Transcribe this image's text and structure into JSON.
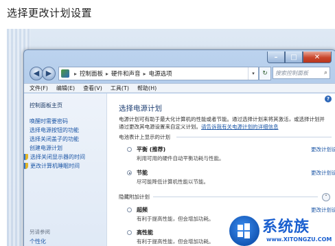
{
  "heading": "选择更改计划设置",
  "window": {
    "caption": {
      "min": "–",
      "max": "□",
      "close": "✕"
    },
    "nav": {
      "back": "◀",
      "forward": "▶"
    },
    "address": {
      "crumbs": [
        "控制面板",
        "硬件和声音",
        "电源选项"
      ],
      "separator": "▸",
      "dropdown": "▾"
    },
    "refresh": "↻",
    "search": {
      "placeholder": "搜索控制面板",
      "icon": "⌕"
    },
    "menu": [
      "文件(F)",
      "编辑(E)",
      "查看(V)",
      "工具(T)",
      "帮助(H)"
    ]
  },
  "sidebar": {
    "home": "控制面板主页",
    "links": [
      "唤醒时需要密码",
      "选择电源按钮的功能",
      "选择关闭盖子的功能",
      "创建电源计划",
      "选择关闭显示器的时间",
      "更改计算机睡眠时间"
    ],
    "see_also": "另请参阅",
    "personalize": "个性化"
  },
  "main": {
    "help": "?",
    "title": "选择电源计划",
    "desc_1": "电源计划可有助于最大化计算机的性能或者节能。通过选择计划来将其激活，或选择计划并通过更改其电源设置来自定义计划。",
    "desc_link": "请告诉我有关电源计划的详细信息",
    "battery_section": "电池表计上显示的计划",
    "hidden_section": "隐藏附加计划",
    "collapse": "˄",
    "plans": [
      {
        "name": "平衡 (推荐)",
        "desc": "利用可用的硬件自动平衡功耗与性能。",
        "change": "更改计划设置",
        "selected": false
      },
      {
        "name": "节能",
        "desc": "尽可能降低计算机性能以节能。",
        "change": "更改计划设置",
        "selected": true
      },
      {
        "name": "超频",
        "desc": "有利于提高性能，但会增加功耗。",
        "change": "更改计划设置",
        "selected": false
      },
      {
        "name": "高性能",
        "desc": "有利于提高性能，但会增加功耗。",
        "change": "",
        "selected": false
      }
    ]
  },
  "watermark": {
    "text": "系统族",
    "url": "www.XITONGZU.COM"
  }
}
